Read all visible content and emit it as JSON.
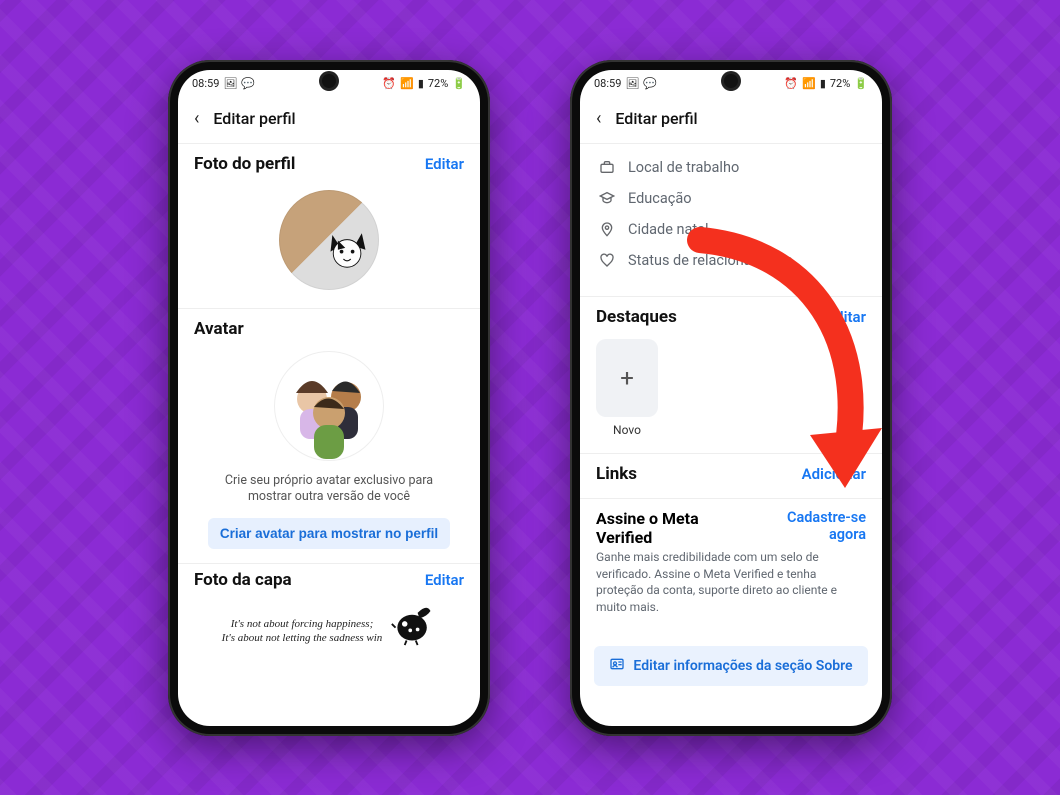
{
  "colors": {
    "accent": "#1877f2",
    "bg_purple": "#8b2bd4",
    "arrow": "#f4301e"
  },
  "statusbar": {
    "time": "08:59",
    "battery": "72%"
  },
  "header": {
    "title": "Editar perfil"
  },
  "left": {
    "profile_photo": {
      "title": "Foto do perfil",
      "edit": "Editar"
    },
    "avatar": {
      "title": "Avatar",
      "desc": "Crie seu próprio avatar exclusivo para mostrar outra versão de você",
      "button": "Criar avatar para mostrar no perfil"
    },
    "cover": {
      "title": "Foto da capa",
      "edit": "Editar",
      "quote_line1": "It's not about forcing happiness;",
      "quote_line2": "It's about not letting the sadness win"
    }
  },
  "right": {
    "info": {
      "items": [
        {
          "icon": "briefcase",
          "label": "Local de trabalho"
        },
        {
          "icon": "grad-cap",
          "label": "Educação"
        },
        {
          "icon": "pin",
          "label": "Cidade natal"
        },
        {
          "icon": "heart",
          "label": "Status de relacionamento"
        }
      ]
    },
    "highlights": {
      "title": "Destaques",
      "edit": "Editar",
      "add_symbol": "+",
      "add_label": "Novo"
    },
    "links": {
      "title": "Links",
      "action": "Adicionar"
    },
    "meta_verified": {
      "title": "Assine o Meta Verified",
      "action": "Cadastre-se agora",
      "desc": "Ganhe mais credibilidade com um selo de verificado. Assine o Meta Verified e tenha proteção da conta, suporte direto ao cliente e muito mais."
    },
    "about_button": "Editar informações da seção Sobre"
  }
}
